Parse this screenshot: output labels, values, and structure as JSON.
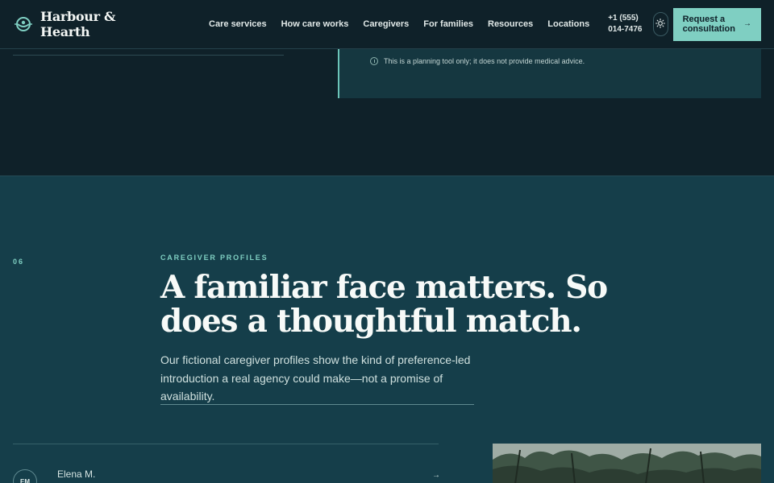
{
  "brand": {
    "name": "Harbour & Hearth"
  },
  "nav": [
    {
      "label": "Care services"
    },
    {
      "label": "How care works"
    },
    {
      "label": "Caregivers"
    },
    {
      "label": "For families"
    },
    {
      "label": "Resources"
    },
    {
      "label": "Locations"
    }
  ],
  "header": {
    "phone": "+1 (555) 014-7476",
    "cta_label": "Request a consultation",
    "theme_icon": "sun-icon"
  },
  "planning_tool": {
    "note": "This is a planning tool only; it does not provide medical advice."
  },
  "caregivers": {
    "section_number": "06",
    "eyebrow": "CAREGIVER PROFILES",
    "headline": "A familiar face matters. So does a thoughtful match.",
    "lede": "Our fictional caregiver profiles show the kind of preference-led introduction a real agency could make—not a promise of availability.",
    "profiles": [
      {
        "initials": "EM",
        "name": "Elena M."
      }
    ]
  },
  "colors": {
    "background": "#0f2129",
    "section_bg": "#153e4a",
    "accent": "#7fcfc2",
    "text": "#f7faf8"
  }
}
